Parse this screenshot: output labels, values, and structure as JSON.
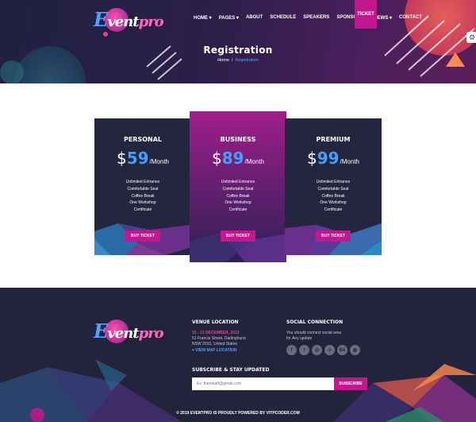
{
  "brand": {
    "logo_initial": "E",
    "logo_rest": "vent",
    "logo_suffix": "pro"
  },
  "nav": {
    "items": [
      {
        "label": "Home",
        "caret": true
      },
      {
        "label": "Pages",
        "caret": true
      },
      {
        "label": "About",
        "caret": false
      },
      {
        "label": "Schedule",
        "caret": false
      },
      {
        "label": "Speakers",
        "caret": false
      },
      {
        "label": "Sponsores",
        "caret": false
      },
      {
        "label": "News",
        "caret": true
      },
      {
        "label": "Contact",
        "caret": false
      }
    ],
    "ticket_label": "TICKET"
  },
  "hero": {
    "title": "Registration",
    "breadcrumb": {
      "home": "Home",
      "separator": "/",
      "current": "Registration"
    }
  },
  "pricing": {
    "plans": [
      {
        "name": "Personal",
        "currency": "$",
        "price": "59",
        "period": "/Month",
        "features": [
          "Unlimited Entrance",
          "Comfortable Seat",
          "Coffee Break",
          "One Workshop",
          "Certificate"
        ],
        "button": "Buy Ticket"
      },
      {
        "name": "Business",
        "currency": "$",
        "price": "89",
        "period": "/Month",
        "features": [
          "Unlimited Entrance",
          "Comfortable Seat",
          "Coffee Break",
          "One Workshop",
          "Certificate"
        ],
        "button": "Buy Ticket"
      },
      {
        "name": "Premium",
        "currency": "$",
        "price": "99",
        "period": "/Month",
        "features": [
          "Unlimited Entrance",
          "Comfortable Seat",
          "Coffee Break",
          "One Workshop",
          "Certificate"
        ],
        "button": "Buy Ticket"
      }
    ]
  },
  "footer": {
    "venue": {
      "heading": "Venue Location",
      "date": "15 - 21 DECEMBER, 2019",
      "address_line1": "51 Francis Street, Darlinghurst",
      "address_line2": "NSW 2010, United States",
      "map_link": "View Map Location"
    },
    "social": {
      "heading": "Social Connection",
      "text_line1": "You should connect social area",
      "text_line2": "for Any update",
      "icons": [
        {
          "name": "facebook-icon",
          "glyph": "f"
        },
        {
          "name": "twitter-icon",
          "glyph": "t"
        },
        {
          "name": "instagram-icon",
          "glyph": "◎"
        },
        {
          "name": "vimeo-icon",
          "glyph": "v"
        },
        {
          "name": "behance-icon",
          "glyph": "Bē"
        },
        {
          "name": "dribbble-icon",
          "glyph": "◍"
        }
      ]
    },
    "subscribe": {
      "heading": "Subscribe & Stay Updated",
      "placeholder": "Ex: themeatf@gmail.com",
      "button": "Subscribe"
    },
    "copyright": "© 2019 EVENTPRO IS PROUDLY POWERED BY VITPCODER.COM"
  },
  "colors": {
    "accent": "#c2178e",
    "blue": "#3fa0ff",
    "dark": "#24263f"
  }
}
